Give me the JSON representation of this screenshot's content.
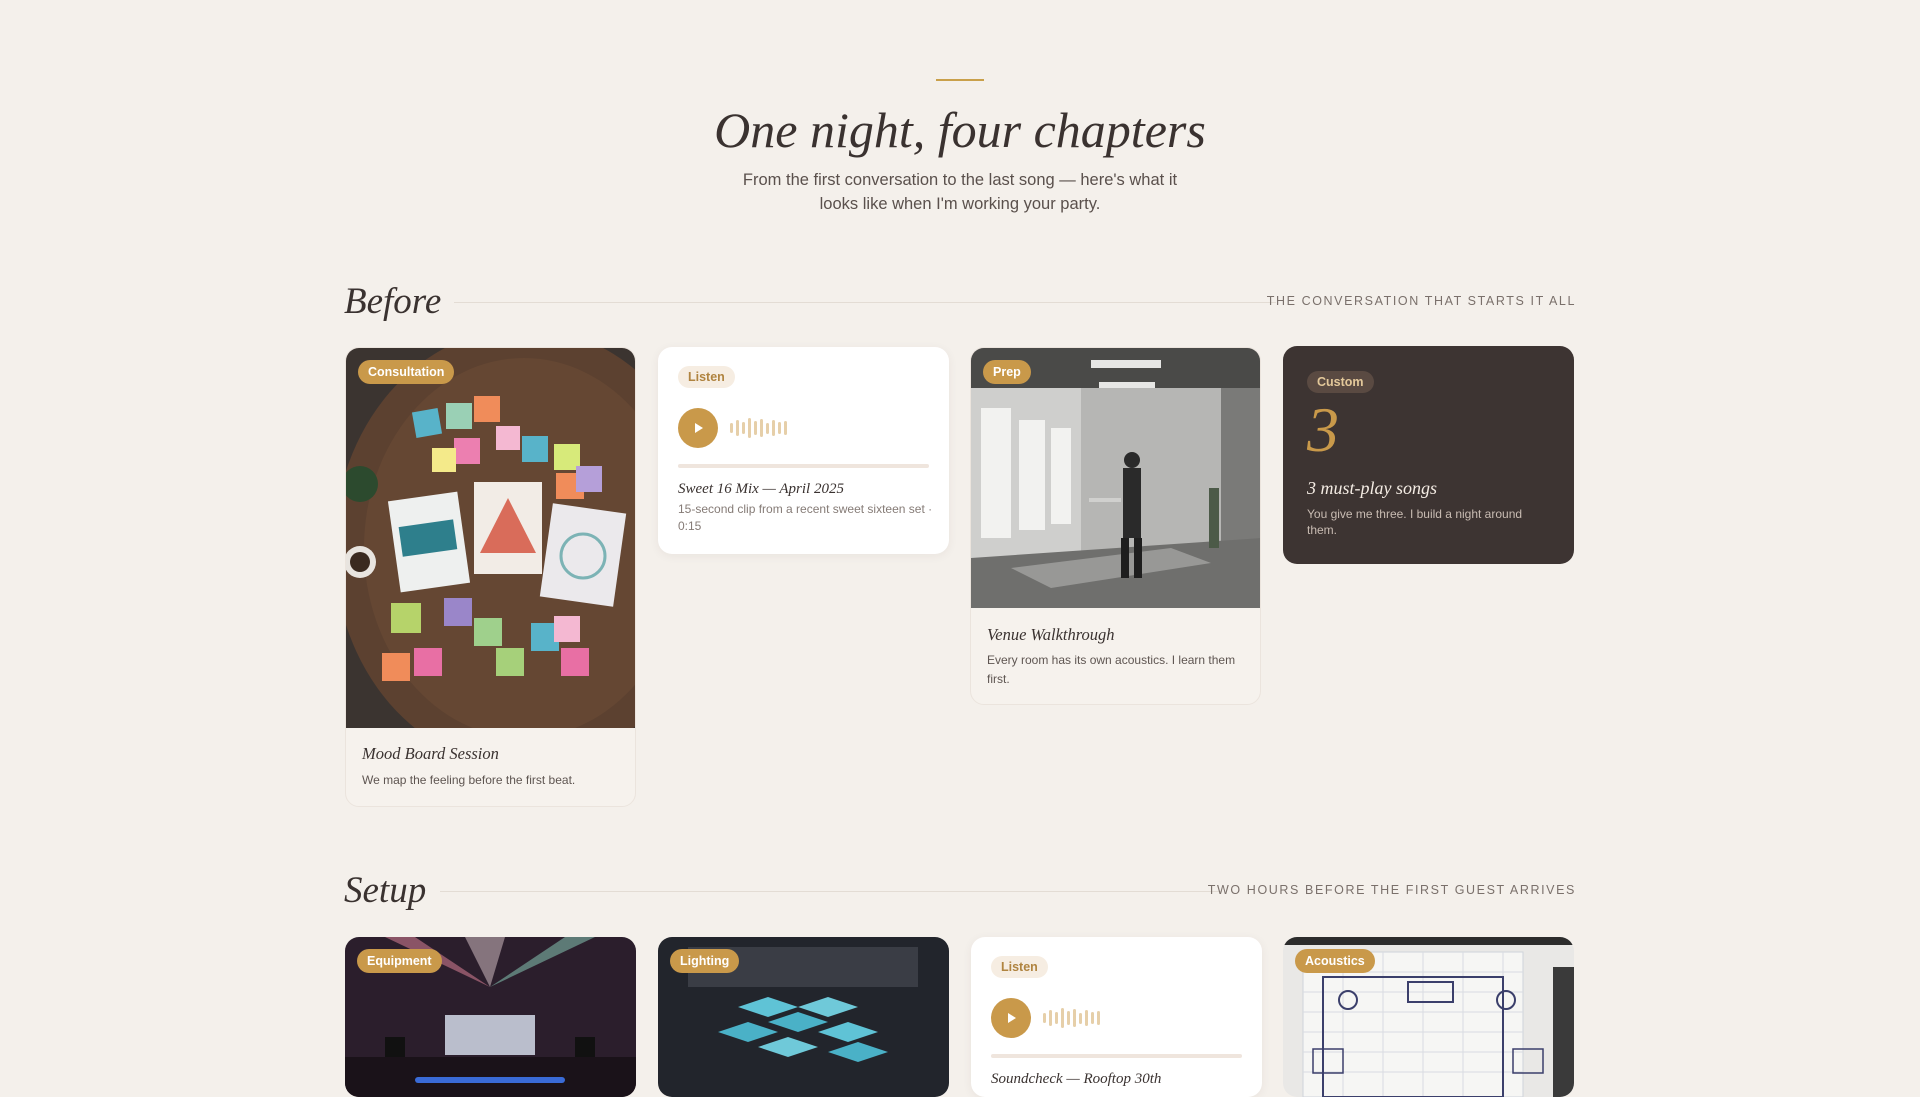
{
  "header": {
    "title": "One night, four chapters",
    "subtitle": "From the first conversation to the last song — here's what it looks like when I'm working your party."
  },
  "sections": [
    {
      "title": "Before",
      "tagline": "THE CONVERSATION THAT STARTS IT ALL",
      "cards": [
        {
          "badge": "Consultation",
          "title": "Mood Board Session",
          "desc": "We map the feeling before the first beat."
        },
        {
          "chip": "Listen",
          "title": "Sweet 16 Mix — April 2025",
          "desc": "15-second clip from a recent sweet sixteen set · 0:15"
        },
        {
          "badge": "Prep",
          "title": "Venue Walkthrough",
          "desc": "Every room has its own acoustics. I learn them first."
        },
        {
          "chip": "Custom",
          "number": "3",
          "title": "3 must-play songs",
          "desc": "You give me three. I build a night around them."
        }
      ]
    },
    {
      "title": "Setup",
      "tagline": "TWO HOURS BEFORE THE FIRST GUEST ARRIVES",
      "cards": [
        {
          "badge": "Equipment"
        },
        {
          "badge": "Lighting"
        },
        {
          "chip": "Listen",
          "title": "Soundcheck — Rooftop 30th"
        },
        {
          "badge": "Acoustics"
        }
      ]
    }
  ],
  "icons": {
    "play": "play-icon",
    "waveform": "waveform-icon"
  },
  "colors": {
    "accent": "#c9994a",
    "background": "#f4f0eb",
    "dark_card": "#3d3432"
  }
}
